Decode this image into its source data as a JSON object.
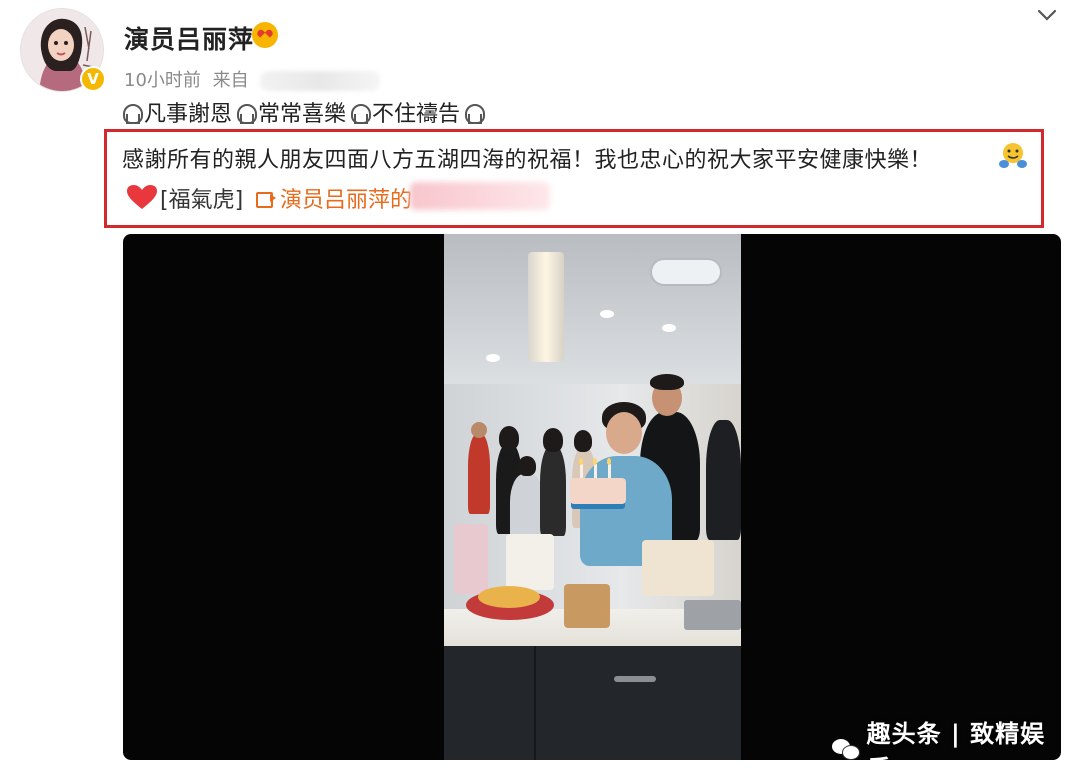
{
  "post": {
    "author_name": "演员吕丽萍",
    "time": "10小时前",
    "source_prefix": "来自",
    "motto": [
      "凡事謝恩",
      "常常喜樂",
      "不住禱告"
    ],
    "body_text": "感謝所有的親人朋友四面八方五湖四海的祝福！我也忠心的祝大家平安健康快樂！",
    "tag_text": "[福氣虎]",
    "video_link_text": "演员吕丽萍的"
  },
  "icons": {
    "verified": "verified-badge-icon",
    "name_emoji": "heart-eyes-emoji-icon",
    "chevron": "chevron-down-icon",
    "pray": "praying-emoji-icon",
    "hug": "hug-emoji-icon",
    "heart": "red-heart-icon",
    "video": "video-icon"
  },
  "video": {
    "watermark": "趣头条 | 致精娱乐"
  },
  "colors": {
    "highlight_border": "#d2282e",
    "link": "#e86b1c",
    "verified": "#f5b800"
  }
}
